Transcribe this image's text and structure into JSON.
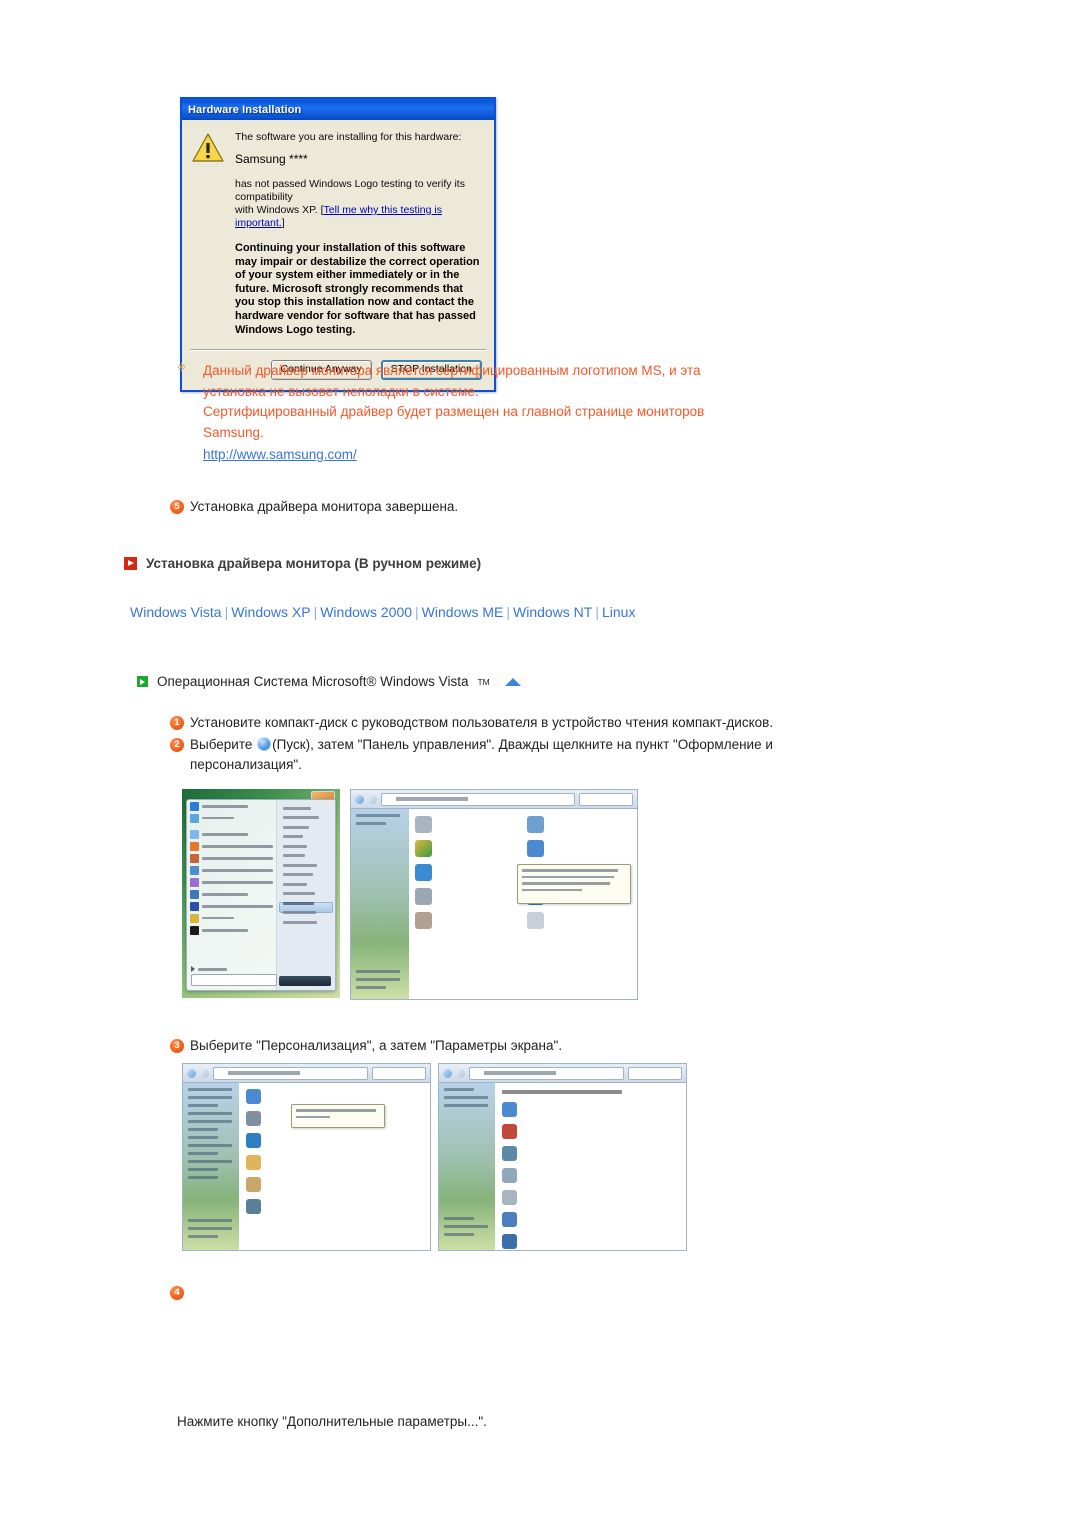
{
  "dialog": {
    "title": "Hardware Installation",
    "icon": "warning-icon",
    "line1": "The software you are installing for this hardware:",
    "device": "Samsung ****",
    "line2a": "has not passed Windows Logo testing to verify its compatibility",
    "line2b": "with Windows XP. [",
    "link": "Tell me why this testing is important.",
    "line2c": "]",
    "warning": "Continuing your installation of this software may impair or destabilize the correct operation of your system either immediately or in the future. Microsoft strongly recommends that you stop this installation now and contact the hardware vendor for software that has passed Windows Logo testing.",
    "buttons": {
      "continue_label": "Continue Anyway",
      "stop_label": "STOP Installation"
    }
  },
  "note": {
    "marker": "※",
    "line1": "Данный драйвер монитора является сертифицированным логотипом MS, и эта",
    "line2": "установка не вызовет неполадки в системе.",
    "line3": "Сертифицированный драйвер будет размещен на главной странице мониторов",
    "line4": "Samsung.",
    "url": "http://www.samsung.com/"
  },
  "step5": {
    "number": "5",
    "text": "Установка драйвера монитора завершена."
  },
  "section": {
    "icon": "play-square-icon",
    "title": "Установка драйвера монитора (В ручном режиме)"
  },
  "os_links": [
    {
      "label": "Windows Vista"
    },
    {
      "label": "Windows XP"
    },
    {
      "label": "Windows 2000"
    },
    {
      "label": "Windows ME"
    },
    {
      "label": "Windows NT"
    },
    {
      "label": "Linux"
    }
  ],
  "os_links_separator": "|",
  "os_heading": {
    "icon": "green-play-icon",
    "text_before": "Операционная Система Microsoft® Windows Vista",
    "trademark": "TM",
    "back_to_top_icon": "up-triangle-icon"
  },
  "steps": [
    {
      "number": "1",
      "text": "Установите компакт-диск с руководством пользователя в устройство чтения компакт-дисков."
    },
    {
      "number": "2",
      "text_part1": "Выберите ",
      "icon": "windows-start-orb-icon",
      "text_part2": "(Пуск), затем \"Панель управления\". Дважды щелкните на пункт \"Оформление и персонализация\"."
    },
    {
      "number": "3",
      "text": "Выберите \"Персонализация\", а затем \"Параметры экрана\"."
    },
    {
      "number": "4",
      "text": ""
    }
  ],
  "final_text": "Нажмите кнопку \"Дополнительные параметры...\".",
  "screenshots": [
    {
      "name": "vista-start-menu",
      "caption": ""
    },
    {
      "name": "vista-control-panel-home",
      "caption": ""
    },
    {
      "name": "vista-appearance-and-personalization",
      "caption": ""
    },
    {
      "name": "vista-personalization",
      "caption": ""
    }
  ],
  "colors": {
    "accent_orange": "#f1592a",
    "link_blue": "#3776d8",
    "title_blue": "#0a4fd6",
    "dialog_face": "#ece9d8",
    "marker_red": "#d42a12",
    "marker_green": "#1aa833"
  }
}
